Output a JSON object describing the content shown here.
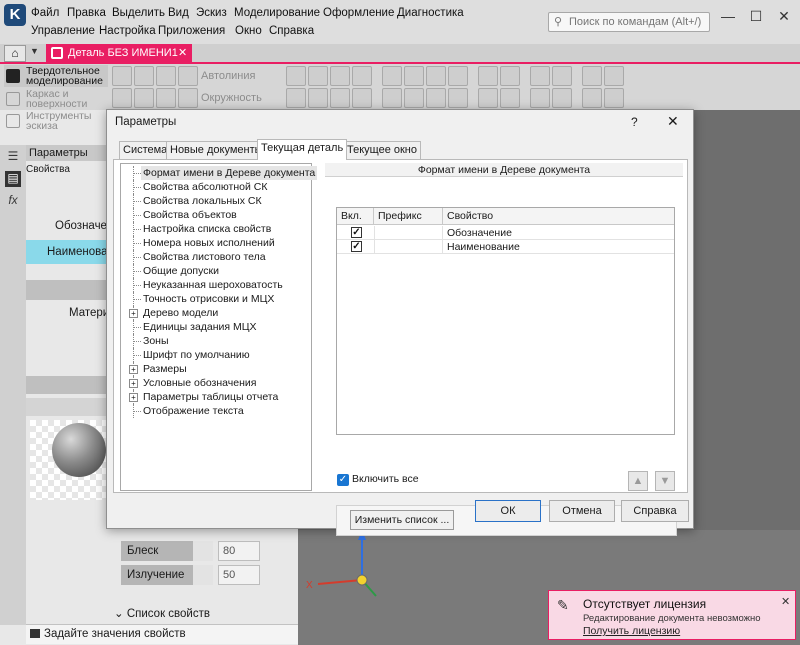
{
  "menu": {
    "row1": [
      "Файл",
      "Правка",
      "Выделить",
      "Вид",
      "Эскиз",
      "Моделирование",
      "Оформление",
      "Диагностика"
    ],
    "row2": [
      "Управление",
      "Настройка",
      "Приложения",
      "Окно",
      "Справка"
    ]
  },
  "search": {
    "placeholder": "Поиск по командам (Alt+/)"
  },
  "window_controls": {
    "minimize": "—",
    "maximize": "☐",
    "close": "✕"
  },
  "tabs": {
    "document_tab": "Деталь БЕЗ ИМЕНИ1",
    "close": "✕"
  },
  "modes": [
    {
      "label": "Твердотельное моделирование"
    },
    {
      "label": "Каркас и поверхности"
    },
    {
      "label": "Инструменты эскиза"
    }
  ],
  "toolbar": {
    "autoline": "Автолиния",
    "circle": "Окружность"
  },
  "left_panel": {
    "title": "Параметры",
    "subtitle": "Свойства",
    "row_designation": "Обозначени",
    "row_name": "Наименован",
    "row_material": "Матери",
    "shine_label": "Блеск",
    "shine_value": "80",
    "emission_label": "Излучение",
    "emission_value": "50",
    "list_footer": "Список свойств",
    "status": "Задайте значения свойств"
  },
  "license": {
    "title": "Отсутствует лицензия",
    "subtitle": "Редактирование документа невозможно",
    "link": "Получить лицензию",
    "close": "✕"
  },
  "dialog": {
    "title": "Параметры",
    "help": "?",
    "close": "✕",
    "tabs": [
      "Система",
      "Новые документы",
      "Текущая деталь",
      "Текущее окно"
    ],
    "active_tab": 2,
    "tree": [
      {
        "label": "Формат имени в Дереве документа",
        "expandable": false,
        "selected": true
      },
      {
        "label": "Свойства абсолютной СК",
        "expandable": false
      },
      {
        "label": "Свойства локальных СК",
        "expandable": false
      },
      {
        "label": "Свойства объектов",
        "expandable": false
      },
      {
        "label": "Настройка списка свойств",
        "expandable": false
      },
      {
        "label": "Номера новых исполнений",
        "expandable": false
      },
      {
        "label": "Свойства листового тела",
        "expandable": false
      },
      {
        "label": "Общие допуски",
        "expandable": false
      },
      {
        "label": "Неуказанная шероховатость",
        "expandable": false
      },
      {
        "label": "Точность отрисовки и МЦХ",
        "expandable": false
      },
      {
        "label": "Дерево модели",
        "expandable": true
      },
      {
        "label": "Единицы задания МЦХ",
        "expandable": false
      },
      {
        "label": "Зоны",
        "expandable": false
      },
      {
        "label": "Шрифт по умолчанию",
        "expandable": false
      },
      {
        "label": "Размеры",
        "expandable": true
      },
      {
        "label": "Условные обозначения",
        "expandable": true
      },
      {
        "label": "Параметры таблицы отчета",
        "expandable": true
      },
      {
        "label": "Отображение текста",
        "expandable": false
      }
    ],
    "panel_title": "Формат имени в Дереве документа",
    "grid": {
      "columns": [
        "Вкл.",
        "Префикс",
        "Свойство"
      ],
      "rows": [
        {
          "enabled": true,
          "prefix": "",
          "property": "Обозначение"
        },
        {
          "enabled": true,
          "prefix": "",
          "property": "Наименование"
        }
      ]
    },
    "include_all": "Включить все",
    "move_up": "▲",
    "move_down": "▼",
    "change_list": "Изменить список ...",
    "ok": "ОК",
    "cancel": "Отмена",
    "help_button": "Справка"
  }
}
